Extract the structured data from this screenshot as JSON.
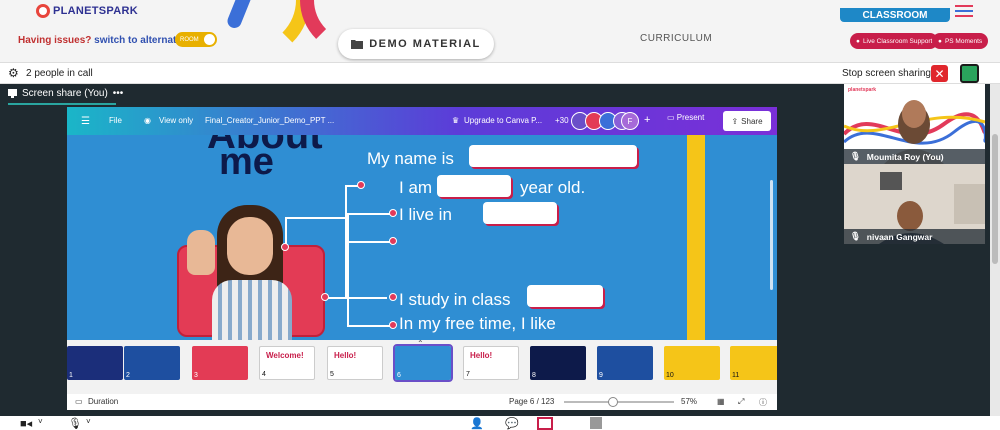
{
  "header": {
    "logo_text": "PLANETSPARK",
    "issue_text": "Having issues?",
    "alt_room_link": "switch to alternate room",
    "room_toggle_label": "ROOM",
    "demo_button": "DEMO MATERIAL",
    "curriculum": "CURRICULUM",
    "classroom_tab": "CLASSROOM",
    "live_support": "Live Classroom Support",
    "ps_moments": "PS Moments"
  },
  "callbar": {
    "people": "2 people in call",
    "stop_sharing": "Stop screen sharing"
  },
  "screen_share_tab": "Screen share (You)",
  "screen_share_more": "•••",
  "canva": {
    "file": "File",
    "view_only": "View only",
    "doc_title": "Final_Creator_Junior_Demo_PPT ...",
    "upgrade": "Upgrade to Canva P...",
    "collab_count": "+30",
    "avatar_letter": "F",
    "plus": "+",
    "present": "Present",
    "share": "Share"
  },
  "slide": {
    "about": "About",
    "me": "me",
    "line1": "My name is",
    "line2a": "I am",
    "line2b": "year old.",
    "line3": "I live in",
    "line4": "I study in class",
    "line5": "In my free time, I like"
  },
  "thumbnails": [
    {
      "n": "1",
      "c": "#1b2e7a"
    },
    {
      "n": "2",
      "c": "#1e4fa0"
    },
    {
      "n": "3",
      "c": "#e33b55"
    },
    {
      "n": "4",
      "c": "#ffffff"
    },
    {
      "n": "5",
      "c": "#ffffff"
    },
    {
      "n": "6",
      "c": "#2f8ed3"
    },
    {
      "n": "7",
      "c": "#ffffff"
    },
    {
      "n": "8",
      "c": "#0d1a4a"
    },
    {
      "n": "9",
      "c": "#1e4fa0"
    },
    {
      "n": "10",
      "c": "#f5c518"
    },
    {
      "n": "11",
      "c": "#f5c518"
    }
  ],
  "thumb_texts": {
    "t4": "Welcome!",
    "t5": "Hello!",
    "t7": "Hello!"
  },
  "footer": {
    "duration": "Duration",
    "page": "Page 6 / 123",
    "zoom": "57%",
    "zoom_level": 0.4
  },
  "participants": [
    {
      "name": "Moumita Roy (You)",
      "brand": "planetspark"
    },
    {
      "name": "nivaan Gangwar"
    }
  ],
  "colors": {
    "accent_red": "#c81e4a",
    "classroom_blue": "#1e88c7",
    "stop_red": "#e0262c",
    "share_green": "#2aa35c",
    "slide_blue": "#2f8ed3"
  }
}
